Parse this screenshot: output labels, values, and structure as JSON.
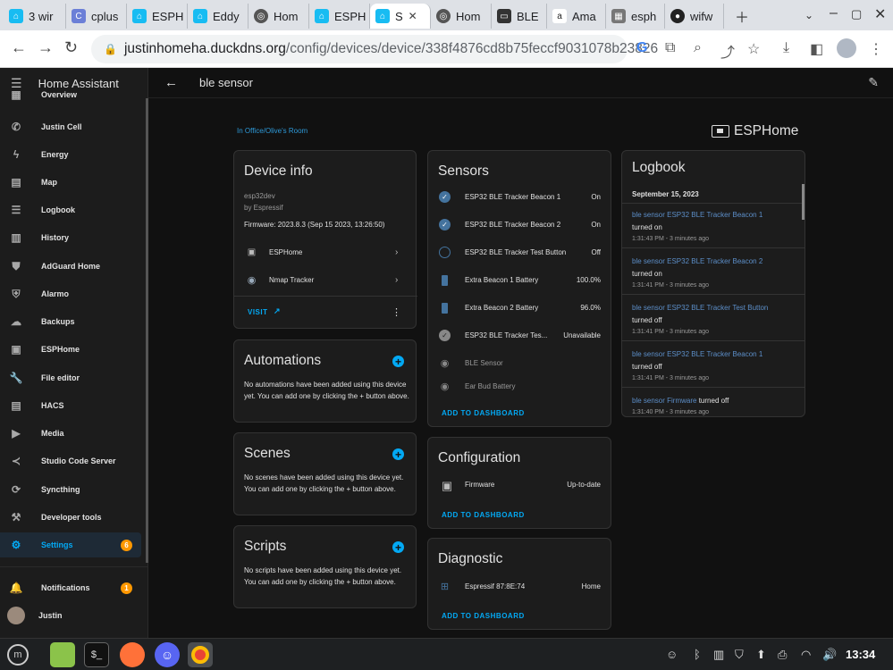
{
  "browser": {
    "tabs": [
      "3 wir",
      "cplus",
      "ESPH",
      "Eddy",
      "Hom",
      "ESPH",
      "S",
      "Hom",
      "BLE",
      "Ama",
      "esph",
      "wifw"
    ],
    "url_domain": "justinhomeha.duckdns.org",
    "url_path": "/config/devices/device/338f4876cd8b75feccf9031078b23826"
  },
  "sidebar": {
    "title": "Home Assistant",
    "items": [
      {
        "label": "Overview",
        "icon": "view-dashboard-icon"
      },
      {
        "label": "Justin Cell",
        "icon": "phone-icon"
      },
      {
        "label": "Energy",
        "icon": "lightning-icon"
      },
      {
        "label": "Map",
        "icon": "map-icon"
      },
      {
        "label": "Logbook",
        "icon": "list-icon"
      },
      {
        "label": "History",
        "icon": "chart-icon"
      },
      {
        "label": "AdGuard Home",
        "icon": "shield-check-icon"
      },
      {
        "label": "Alarmo",
        "icon": "shield-home-icon"
      },
      {
        "label": "Backups",
        "icon": "cloud-icon"
      },
      {
        "label": "ESPHome",
        "icon": "chip-icon"
      },
      {
        "label": "File editor",
        "icon": "wrench-icon"
      },
      {
        "label": "HACS",
        "icon": "hacs-icon"
      },
      {
        "label": "Media",
        "icon": "play-box-icon"
      },
      {
        "label": "Studio Code Server",
        "icon": "vscode-icon"
      },
      {
        "label": "Syncthing",
        "icon": "sync-icon"
      },
      {
        "label": "Developer tools",
        "icon": "hammer-icon"
      },
      {
        "label": "Settings",
        "icon": "cog-icon",
        "badge": "6"
      }
    ],
    "notifications": {
      "label": "Notifications",
      "badge": "1"
    },
    "user": {
      "label": "Justin"
    }
  },
  "header": {
    "title": "ble sensor"
  },
  "area": "In Office/Olive's Room",
  "brand": "ESPHome",
  "device_info": {
    "title": "Device info",
    "model": "esp32dev",
    "manufacturer": "by Espressif",
    "firmware": "Firmware: 2023.8.3 (Sep 15 2023, 13:26:50)",
    "integrations": [
      "ESPHome",
      "Nmap Tracker"
    ],
    "visit": "VISIT"
  },
  "automations": {
    "title": "Automations",
    "text": "No automations have been added using this device yet. You can add one by clicking the + button above."
  },
  "scenes": {
    "title": "Scenes",
    "text": "No scenes have been added using this device yet. You can add one by clicking the + button above."
  },
  "scripts": {
    "title": "Scripts",
    "text": "No scripts have been added using this device yet. You can add one by clicking the + button above."
  },
  "sensors": {
    "title": "Sensors",
    "rows": [
      {
        "name": "ESP32 BLE Tracker Beacon 1",
        "value": "On"
      },
      {
        "name": "ESP32 BLE Tracker Beacon 2",
        "value": "On"
      },
      {
        "name": "ESP32 BLE Tracker Test Button",
        "value": "Off"
      },
      {
        "name": "Extra Beacon 1 Battery",
        "value": "100.0%"
      },
      {
        "name": "Extra Beacon 2 Battery",
        "value": "96.0%"
      },
      {
        "name": "ESP32 BLE Tracker Tes...",
        "value": "Unavailable"
      },
      {
        "name": "BLE Sensor",
        "value": ""
      },
      {
        "name": "Ear Bud Battery",
        "value": ""
      }
    ],
    "add": "ADD TO DASHBOARD"
  },
  "configuration": {
    "title": "Configuration",
    "rows": [
      {
        "name": "Firmware",
        "value": "Up-to-date"
      }
    ],
    "add": "ADD TO DASHBOARD"
  },
  "diagnostic": {
    "title": "Diagnostic",
    "rows": [
      {
        "name": "Espressif 87:8E:74",
        "value": "Home"
      }
    ],
    "add": "ADD TO DASHBOARD"
  },
  "logbook": {
    "title": "Logbook",
    "date": "September 15, 2023",
    "entries": [
      {
        "link": "ble sensor ESP32 BLE Tracker Beacon 1",
        "action": "turned on",
        "time": "1:31:43 PM - 3 minutes ago"
      },
      {
        "link": "ble sensor ESP32 BLE Tracker Beacon 2",
        "action": "turned on",
        "time": "1:31:41 PM - 3 minutes ago"
      },
      {
        "link": "ble sensor ESP32 BLE Tracker Test Button",
        "action": "turned off",
        "time": "1:31:41 PM - 3 minutes ago"
      },
      {
        "link": "ble sensor ESP32 BLE Tracker Beacon 1",
        "action": "turned off",
        "time": "1:31:41 PM - 3 minutes ago"
      },
      {
        "link": "ble sensor Firmware",
        "action": "turned off",
        "time": "1:31:40 PM - 3 minutes ago"
      }
    ]
  },
  "taskbar": {
    "clock": "13:34"
  }
}
